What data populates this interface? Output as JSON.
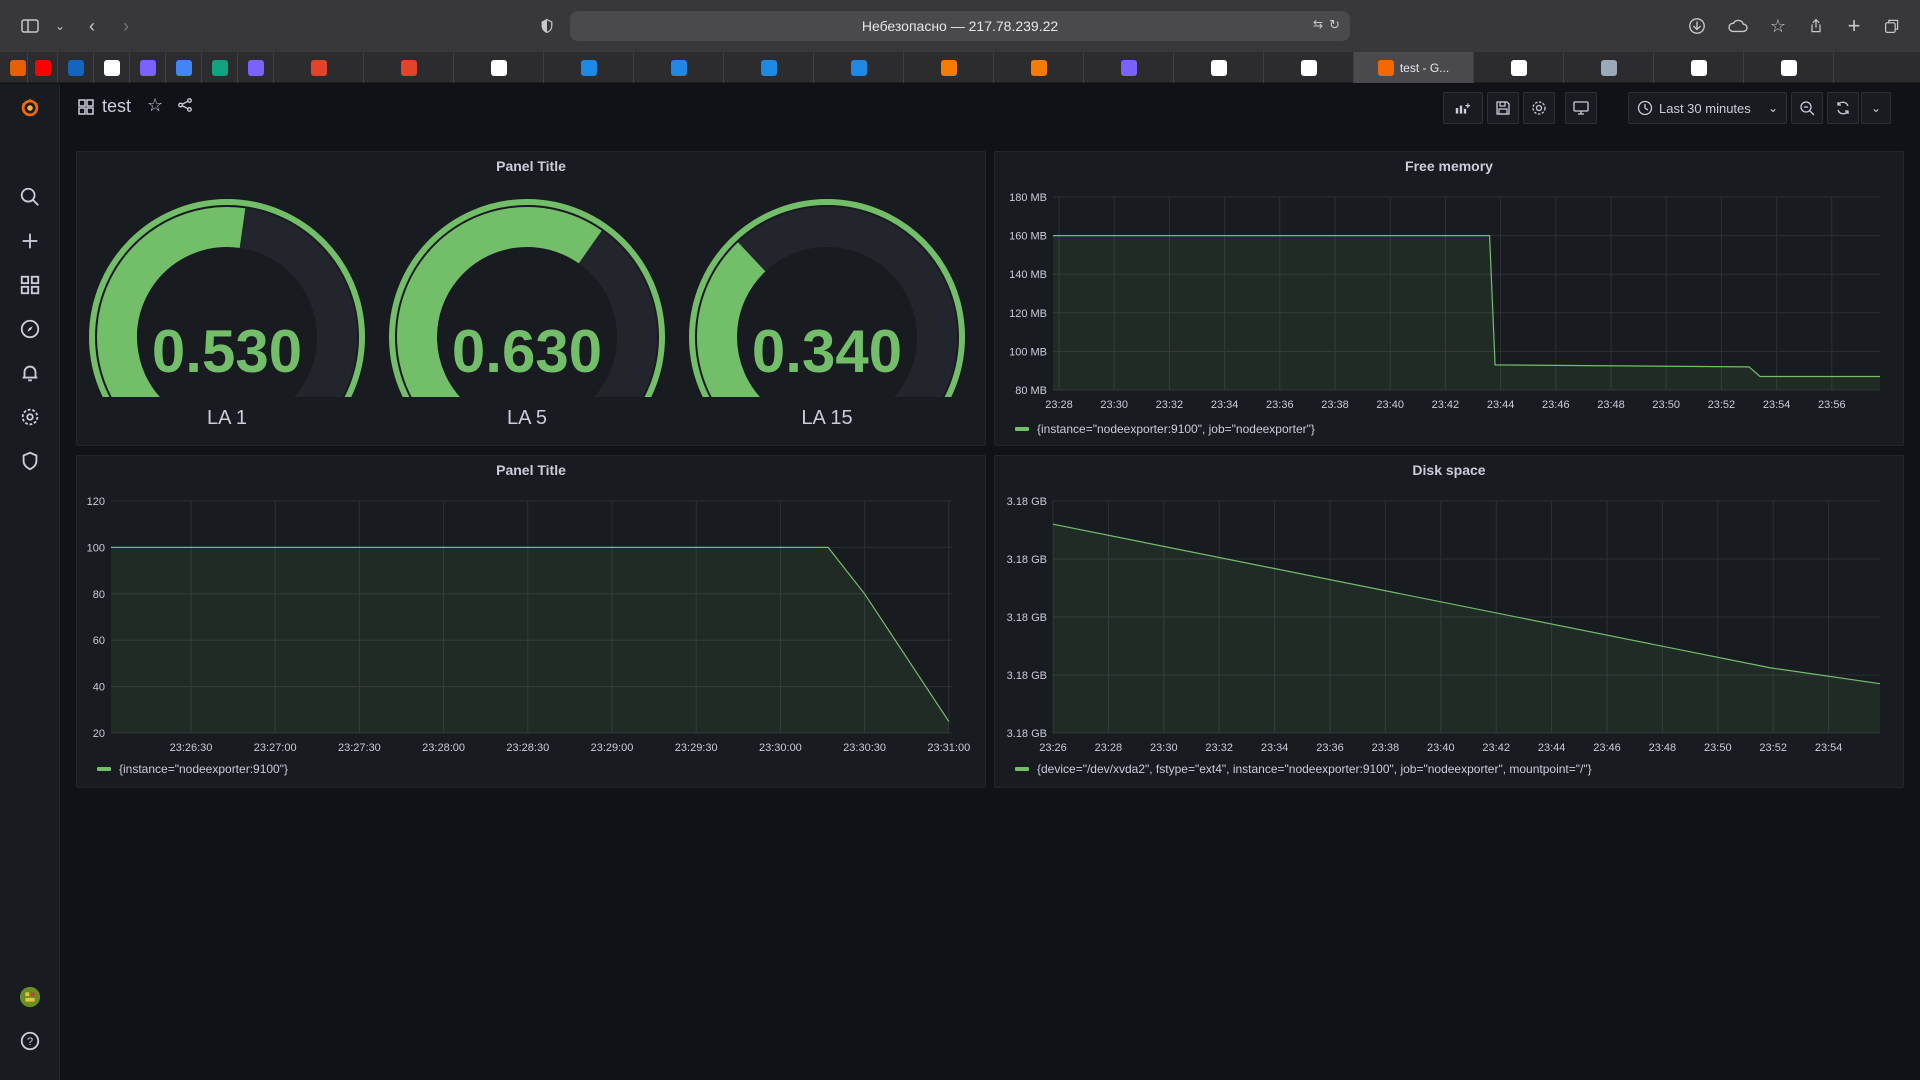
{
  "browser": {
    "address": "Небезопасно — 217.78.239.22",
    "active_tab_title": "test - G...",
    "bookmark_icons": [
      "firefox-icon",
      "youtube-icon",
      "mail-icon",
      "github-icon",
      "app-icon",
      "translate-icon",
      "chatgpt-icon",
      "app-icon",
      "gitlab-icon",
      "gitlab-icon",
      "netology-icon",
      "refresh-icon",
      "refresh-icon",
      "refresh-icon",
      "refresh-icon",
      "cross-icon",
      "cross-icon",
      "app-icon",
      "github-icon",
      "google-icon",
      "grafana-icon",
      "google-icon",
      "app-icon",
      "google-icon",
      "github-icon"
    ]
  },
  "dashboard": {
    "title": "test",
    "time_range": "Last 30 minutes"
  },
  "gauges": {
    "panel_title": "Panel Title",
    "items": [
      {
        "value": "0.530",
        "label": "LA 1",
        "fraction": 0.53
      },
      {
        "value": "0.630",
        "label": "LA 5",
        "fraction": 0.63
      },
      {
        "value": "0.340",
        "label": "LA 15",
        "fraction": 0.34
      }
    ],
    "colors": {
      "fill": "#73bf69",
      "track": "#22252b"
    }
  },
  "free_memory": {
    "title": "Free memory",
    "legend": "{instance=\"nodeexporter:9100\", job=\"nodeexporter\"}",
    "y_ticks": [
      "180 MB",
      "160 MB",
      "140 MB",
      "120 MB",
      "100 MB",
      "80 MB"
    ],
    "x_ticks": [
      "23:28",
      "23:30",
      "23:32",
      "23:34",
      "23:36",
      "23:38",
      "23:40",
      "23:42",
      "23:44",
      "23:46",
      "23:48",
      "23:50",
      "23:52",
      "23:54",
      "23:56"
    ]
  },
  "la_panel": {
    "title": "Panel Title",
    "legend": "{instance=\"nodeexporter:9100\"}",
    "y_ticks": [
      "120",
      "100",
      "80",
      "60",
      "40",
      "20"
    ],
    "x_ticks": [
      "23:26:30",
      "23:27:00",
      "23:27:30",
      "23:28:00",
      "23:28:30",
      "23:29:00",
      "23:29:30",
      "23:30:00",
      "23:30:30",
      "23:31:00"
    ]
  },
  "disk_space": {
    "title": "Disk space",
    "legend": "{device=\"/dev/xvda2\", fstype=\"ext4\", instance=\"nodeexporter:9100\", job=\"nodeexporter\", mountpoint=\"/\"}",
    "y_ticks": [
      "3.18 GB",
      "3.18 GB",
      "3.18 GB",
      "3.18 GB",
      "3.18 GB"
    ],
    "x_ticks": [
      "23:26",
      "23:28",
      "23:30",
      "23:32",
      "23:34",
      "23:36",
      "23:38",
      "23:40",
      "23:42",
      "23:44",
      "23:46",
      "23:48",
      "23:50",
      "23:52",
      "23:54"
    ]
  },
  "chart_data": [
    {
      "type": "area",
      "title": "Free memory",
      "ylabel": "",
      "ylim": [
        80,
        180
      ],
      "series": [
        {
          "name": "{instance=\"nodeexporter:9100\", job=\"nodeexporter\"}",
          "x": [
            "23:28",
            "23:43.6",
            "23:43.8",
            "23:53",
            "23:53.4",
            "23:57"
          ],
          "values": [
            160,
            160,
            93,
            92,
            87,
            87
          ]
        }
      ]
    },
    {
      "type": "area",
      "title": "Panel Title",
      "ylim": [
        20,
        120
      ],
      "series": [
        {
          "name": "{instance=\"nodeexporter:9100\"}",
          "x": [
            "23:26:00",
            "23:30:17",
            "23:30:30",
            "23:31:00"
          ],
          "values": [
            100,
            100,
            80,
            25
          ]
        }
      ]
    },
    {
      "type": "area",
      "title": "Disk space",
      "ylim": [
        0,
        4
      ],
      "series": [
        {
          "name": "{device=\"/dev/xvda2\", fstype=\"ext4\", instance=\"nodeexporter:9100\", job=\"nodeexporter\", mountpoint=\"/\"}",
          "x": [
            "23:26",
            "23:56"
          ],
          "values": [
            3.6,
            0.85
          ]
        }
      ]
    }
  ]
}
